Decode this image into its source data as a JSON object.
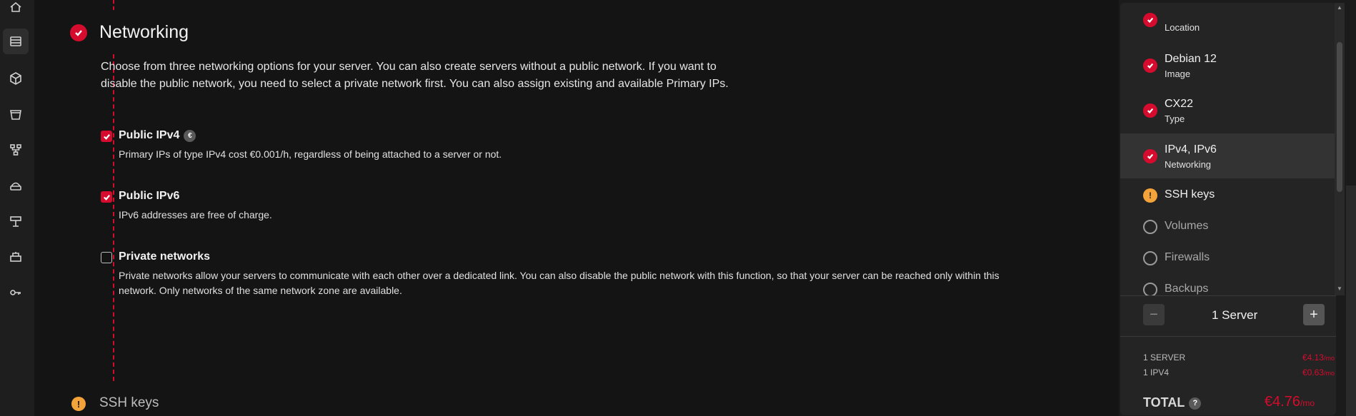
{
  "rail": {
    "icons": [
      "home-icon",
      "servers-icon",
      "cube-icon",
      "bucket-icon",
      "network-icon",
      "load-balancer-icon",
      "firewall-icon",
      "floating-ip-icon",
      "key-icon"
    ]
  },
  "networking": {
    "title": "Networking",
    "intro": "Choose from three networking options for your server. You can also create servers without a public network. If you want to disable the public network, you need to select a private network first. You can also assign existing and available Primary IPs.",
    "options": [
      {
        "title": "Public IPv4",
        "badge": "€",
        "desc": "Primary IPs of type IPv4 cost €0.001/h, regardless of being attached to a server or not.",
        "checked": true
      },
      {
        "title": "Public IPv6",
        "desc": "IPv6 addresses are free of charge.",
        "checked": true
      },
      {
        "title": "Private networks",
        "desc": "Private networks allow your servers to communicate with each other over a dedicated link. You can also disable the public network with this function, so that your server can be reached only within this network. Only networks of the same network zone are available.",
        "checked": false
      }
    ]
  },
  "next_step": {
    "title": "SSH keys",
    "mark": "!"
  },
  "summary": {
    "steps": [
      {
        "main": "",
        "sub": "Location",
        "state": "done"
      },
      {
        "main": "Debian 12",
        "sub": "Image",
        "state": "done"
      },
      {
        "main": "CX22",
        "sub": "Type",
        "state": "done"
      },
      {
        "main": "IPv4, IPv6",
        "sub": "Networking",
        "state": "done-active"
      },
      {
        "main": "SSH keys",
        "sub": "",
        "state": "warn"
      },
      {
        "main": "Volumes",
        "sub": "",
        "state": "empty"
      },
      {
        "main": "Firewalls",
        "sub": "",
        "state": "empty"
      },
      {
        "main": "Backups",
        "sub": "",
        "state": "empty"
      }
    ],
    "warn_mark": "!",
    "quantity": {
      "minus": "−",
      "label": "1 Server",
      "plus": "+"
    },
    "prices": [
      {
        "label": "1 SERVER",
        "value": "€4.13",
        "unit": "/mo"
      },
      {
        "label": "1 IPV4",
        "value": "€0.63",
        "unit": "/mo"
      }
    ],
    "total": {
      "label": "TOTAL",
      "help": "?",
      "value": "€4.76",
      "unit": "/mo"
    }
  },
  "colors": {
    "accent": "#d50c2d",
    "warning": "#f3a33a",
    "background": "#141414"
  }
}
